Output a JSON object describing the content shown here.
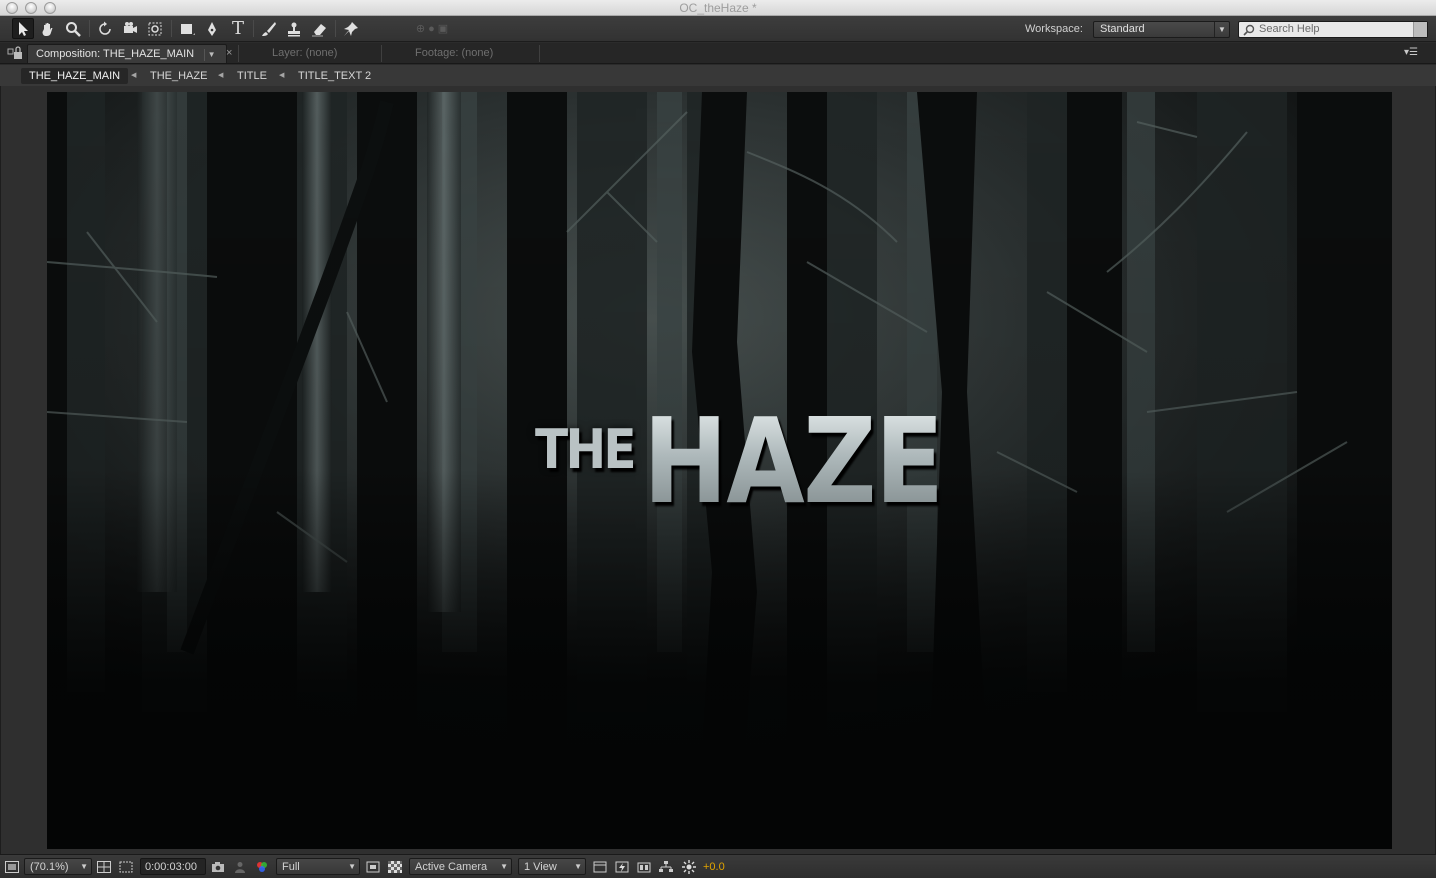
{
  "window": {
    "title": "OC_theHaze *"
  },
  "toolbar": {
    "tools": [
      "selection-tool",
      "hand-tool",
      "zoom-tool",
      "rotation-tool",
      "orbit-camera-tool",
      "pan-behind-tool",
      "rectangle-tool",
      "pen-tool",
      "type-tool",
      "brush-tool",
      "clone-stamp-tool",
      "eraser-tool",
      "puppet-pin-tool"
    ],
    "workspace_label": "Workspace:",
    "workspace_value": "Standard",
    "search_placeholder": "Search Help"
  },
  "panel_tabs": {
    "composition": "Composition: THE_HAZE_MAIN",
    "layer": "Layer: (none)",
    "footage": "Footage: (none)"
  },
  "breadcrumbs": [
    "THE_HAZE_MAIN",
    "THE_HAZE",
    "TITLE",
    "TITLE_TEXT 2"
  ],
  "composition": {
    "title_word1": "THE",
    "title_word2": "HAZE"
  },
  "viewer_controls": {
    "magnification": "(70.1%)",
    "timecode": "0:00:03:00",
    "resolution": "Full",
    "camera": "Active Camera",
    "views": "1 View",
    "exposure": "+0.0"
  },
  "colors": {
    "accent_exposure": "#e1a400",
    "panel_bg": "#2b2b2b",
    "comp_bg": "#050606"
  }
}
